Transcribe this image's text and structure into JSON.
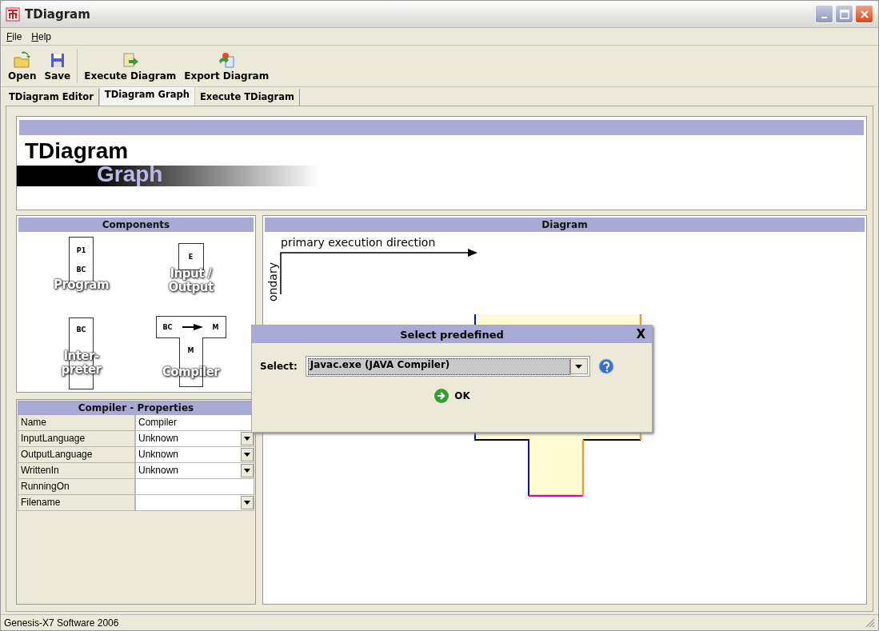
{
  "window": {
    "title": "TDiagram"
  },
  "menu": [
    "File",
    "Help"
  ],
  "toolbar": [
    [
      {
        "label": "Open"
      },
      {
        "label": "Save"
      }
    ],
    [
      {
        "label": "Execute Diagram"
      },
      {
        "label": "Export Diagram"
      }
    ]
  ],
  "tabs": [
    {
      "label": "TDiagram Editor",
      "selected": false
    },
    {
      "label": "TDiagram Graph",
      "selected": true
    },
    {
      "label": "Execute TDiagram",
      "selected": false
    }
  ],
  "banner": {
    "title": "TDiagram",
    "subtitle": "Graph"
  },
  "components": {
    "title": "Components",
    "items": [
      {
        "kind": "program",
        "label": [
          "Program"
        ],
        "texts": [
          "P1",
          "BC"
        ]
      },
      {
        "kind": "io",
        "label": [
          "Input /",
          "Output"
        ],
        "texts": [
          "E"
        ]
      },
      {
        "kind": "interpreter",
        "label": [
          "Inter-",
          "preter"
        ],
        "texts": [
          "BC"
        ]
      },
      {
        "kind": "compiler",
        "label": [
          "Compiler"
        ],
        "texts": [
          "BC",
          "M",
          "M"
        ]
      }
    ]
  },
  "properties": {
    "title": "Compiler - Properties",
    "rows": [
      {
        "name": "Name",
        "kind": "text",
        "value": "Compiler"
      },
      {
        "name": "InputLanguage",
        "kind": "dropdown",
        "value": "Unknown"
      },
      {
        "name": "OutputLanguage",
        "kind": "dropdown",
        "value": "Unknown"
      },
      {
        "name": "WrittenIn",
        "kind": "dropdown",
        "value": "Unknown"
      },
      {
        "name": "RunningOn",
        "kind": "text"
      },
      {
        "name": "Filename",
        "kind": "dropdown"
      }
    ]
  },
  "diagram": {
    "title": "Diagram",
    "primary_axis": "primary execution direction",
    "secondary_axis": "ondary"
  },
  "dialog": {
    "title": "Select predefined",
    "close": "X",
    "label": "Select:",
    "value": "Javac.exe (JAVA Compiler)",
    "ok": "OK"
  },
  "status_bar": "Genesis-X7 Software 2006"
}
